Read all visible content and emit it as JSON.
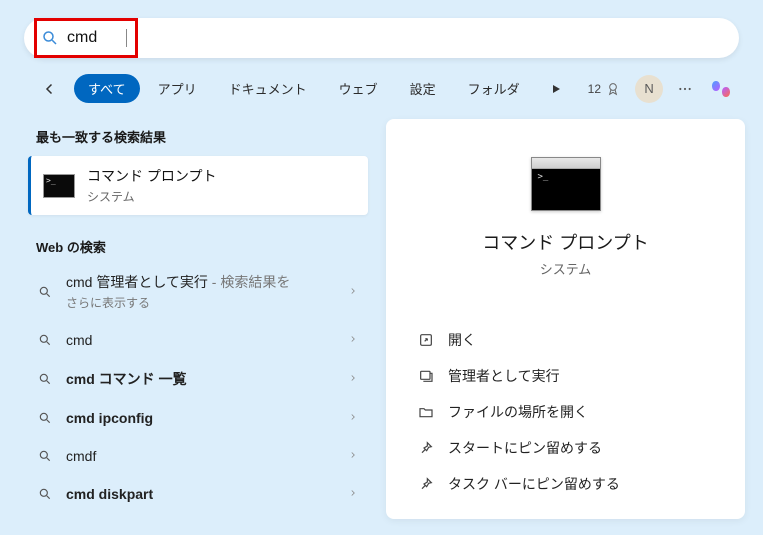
{
  "search": {
    "value": "cmd"
  },
  "tabs": {
    "back": "←",
    "all": "すべて",
    "apps": "アプリ",
    "documents": "ドキュメント",
    "web": "ウェブ",
    "settings": "設定",
    "folders": "フォルダ"
  },
  "rewards": {
    "points": "12"
  },
  "avatar": {
    "initial": "N"
  },
  "left": {
    "best_match_header": "最も一致する検索結果",
    "best_match": {
      "title": "コマンド プロンプト",
      "subtitle": "システム"
    },
    "web_header": "Web の検索",
    "items": [
      {
        "primary": "cmd 管理者として実行",
        "secondary": " - 検索結果をさらに表示する",
        "multiline": true,
        "bold": false
      },
      {
        "primary": "cmd",
        "secondary": "",
        "bold": false
      },
      {
        "primary": "cmd コマンド 一覧",
        "secondary": "",
        "bold": true
      },
      {
        "primary": "cmd ipconfig",
        "secondary": "",
        "bold": true
      },
      {
        "primary": "cmdf",
        "secondary": "",
        "bold": false
      },
      {
        "primary": "cmd diskpart",
        "secondary": "",
        "bold": true
      }
    ]
  },
  "preview": {
    "title": "コマンド プロンプト",
    "subtitle": "システム",
    "actions": {
      "open": "開く",
      "run_admin": "管理者として実行",
      "open_location": "ファイルの場所を開く",
      "pin_start": "スタートにピン留めする",
      "pin_taskbar": "タスク バーにピン留めする"
    }
  }
}
